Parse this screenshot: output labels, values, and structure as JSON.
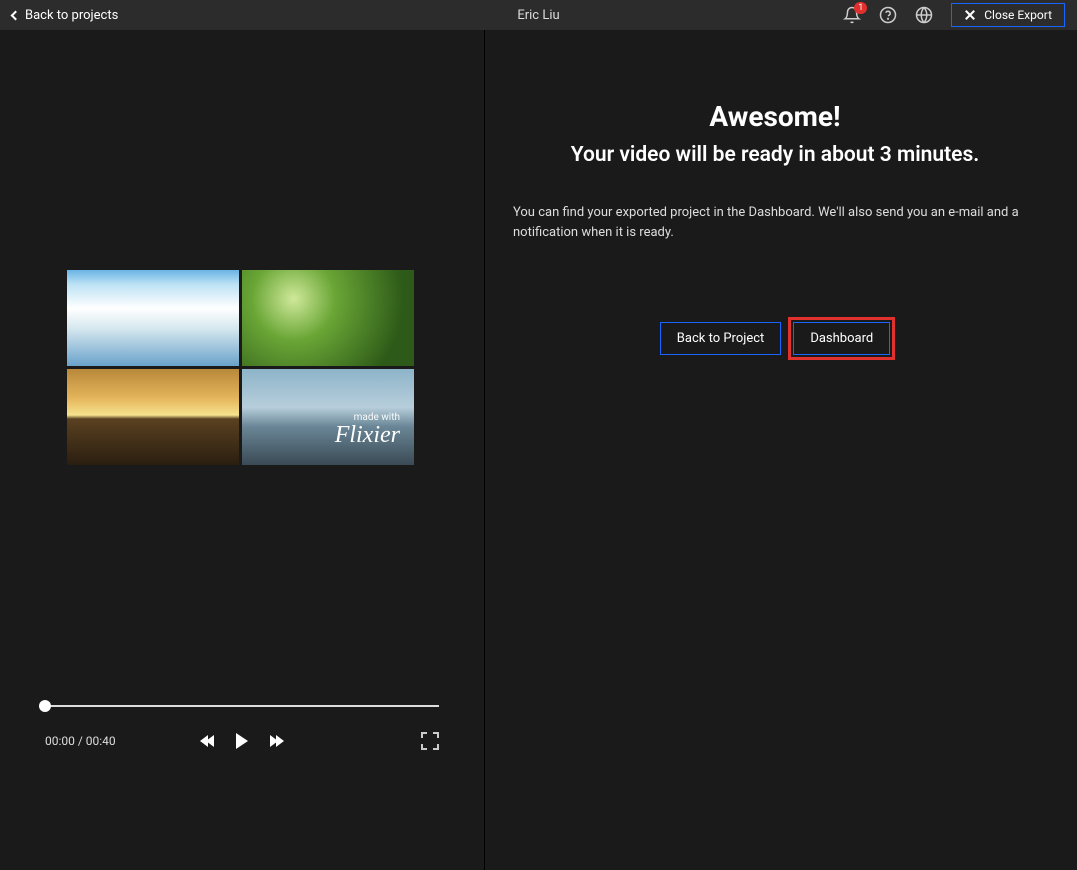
{
  "topbar": {
    "back_label": "Back to projects",
    "user_name": "Eric Liu",
    "notification_count": "1",
    "close_export_label": "Close Export"
  },
  "preview": {
    "watermark_small": "made with",
    "watermark_brand": "Flixier",
    "time_display": "00:00 / 00:40"
  },
  "export": {
    "headline": "Awesome!",
    "subhead": "Your video will be ready in about 3 minutes.",
    "body": "You can find your exported project in the Dashboard. We'll also send you an e-mail and a notification when it is ready.",
    "back_to_project_label": "Back to Project",
    "dashboard_label": "Dashboard"
  }
}
